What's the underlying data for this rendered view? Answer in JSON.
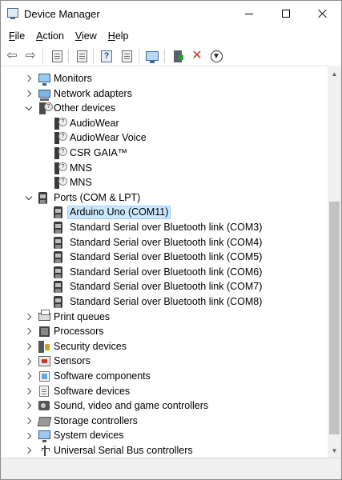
{
  "window": {
    "title": "Device Manager",
    "controls": {
      "minimize": "minimize",
      "maximize": "maximize",
      "close": "close"
    }
  },
  "menu": [
    {
      "label": "File",
      "mnemonic": "F",
      "rest": "ile"
    },
    {
      "label": "Action",
      "mnemonic": "A",
      "rest": "ction"
    },
    {
      "label": "View",
      "mnemonic": "V",
      "rest": "iew"
    },
    {
      "label": "Help",
      "mnemonic": "H",
      "rest": "elp"
    }
  ],
  "toolbar": [
    "back-arrow-icon",
    "forward-arrow-icon",
    "properties-icon",
    "device-list-icon",
    "help-icon",
    "action-pane-icon",
    "scan-hardware-icon",
    "update-driver-icon",
    "uninstall-device-icon",
    "download-icon"
  ],
  "tree": {
    "items": [
      {
        "label": "Monitors",
        "expander": "collapsed",
        "icon": "monitor-icon"
      },
      {
        "label": "Network adapters",
        "expander": "collapsed",
        "icon": "network-adapter-icon"
      },
      {
        "label": "Other devices",
        "expander": "expanded",
        "icon": "other-devices-icon"
      },
      {
        "label": "AudioWear",
        "icon": "unknown-device-icon"
      },
      {
        "label": "AudioWear Voice",
        "icon": "unknown-device-icon"
      },
      {
        "label": "CSR GAIA™",
        "icon": "unknown-device-icon"
      },
      {
        "label": "MNS",
        "icon": "unknown-device-icon"
      },
      {
        "label": "MNS",
        "icon": "unknown-device-icon"
      },
      {
        "label": "Ports (COM & LPT)",
        "expander": "expanded",
        "icon": "port-icon"
      },
      {
        "label": "Arduino Uno (COM11)",
        "icon": "port-icon",
        "selected": true
      },
      {
        "label": "Standard Serial over Bluetooth link (COM3)",
        "icon": "port-icon"
      },
      {
        "label": "Standard Serial over Bluetooth link (COM4)",
        "icon": "port-icon"
      },
      {
        "label": "Standard Serial over Bluetooth link (COM5)",
        "icon": "port-icon"
      },
      {
        "label": "Standard Serial over Bluetooth link (COM6)",
        "icon": "port-icon"
      },
      {
        "label": "Standard Serial over Bluetooth link (COM7)",
        "icon": "port-icon"
      },
      {
        "label": "Standard Serial over Bluetooth link (COM8)",
        "icon": "port-icon"
      },
      {
        "label": "Print queues",
        "expander": "collapsed",
        "icon": "print-queue-icon"
      },
      {
        "label": "Processors",
        "expander": "collapsed",
        "icon": "processor-icon"
      },
      {
        "label": "Security devices",
        "expander": "collapsed",
        "icon": "security-device-icon"
      },
      {
        "label": "Sensors",
        "expander": "collapsed",
        "icon": "sensor-icon"
      },
      {
        "label": "Software components",
        "expander": "collapsed",
        "icon": "software-component-icon"
      },
      {
        "label": "Software devices",
        "expander": "collapsed",
        "icon": "software-device-icon"
      },
      {
        "label": "Sound, video and game controllers",
        "expander": "collapsed",
        "icon": "sound-controller-icon"
      },
      {
        "label": "Storage controllers",
        "expander": "collapsed",
        "icon": "storage-controller-icon"
      },
      {
        "label": "System devices",
        "expander": "collapsed",
        "icon": "system-device-icon"
      },
      {
        "label": "Universal Serial Bus controllers",
        "expander": "collapsed",
        "icon": "usb-controller-icon"
      }
    ]
  },
  "scrollbar": {
    "vertical_thumb_position": 0.35,
    "vertical_thumb_fraction": 0.62
  },
  "colors": {
    "selection_bg": "#cce8ff",
    "selection_border": "#99d1ff",
    "scrollbar_thumb": "#c2c2c2"
  }
}
